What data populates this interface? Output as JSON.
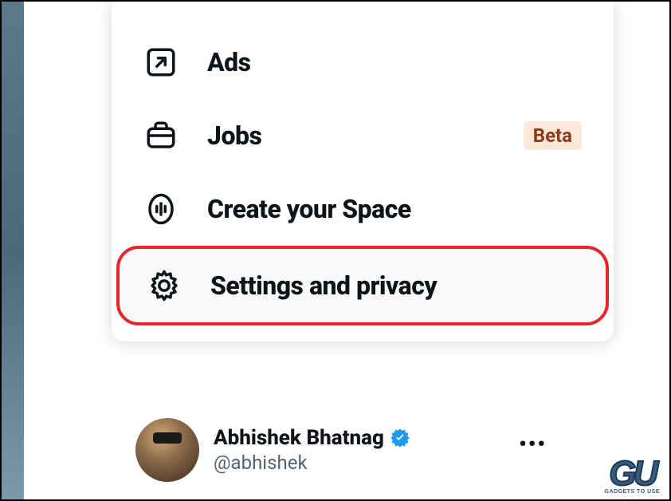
{
  "menu": {
    "items": [
      {
        "label": "Ads",
        "icon": "arrow-up-right-box"
      },
      {
        "label": "Jobs",
        "icon": "briefcase",
        "badge": "Beta"
      },
      {
        "label": "Create your Space",
        "icon": "mic-space"
      },
      {
        "label": "Settings and privacy",
        "icon": "gear",
        "highlighted": true
      }
    ]
  },
  "profile": {
    "name": "Abhishek Bhatnag",
    "handle": "@abhishek",
    "verified": true
  },
  "watermark": {
    "logo": "GU",
    "text": "GADGETS TO USE"
  }
}
